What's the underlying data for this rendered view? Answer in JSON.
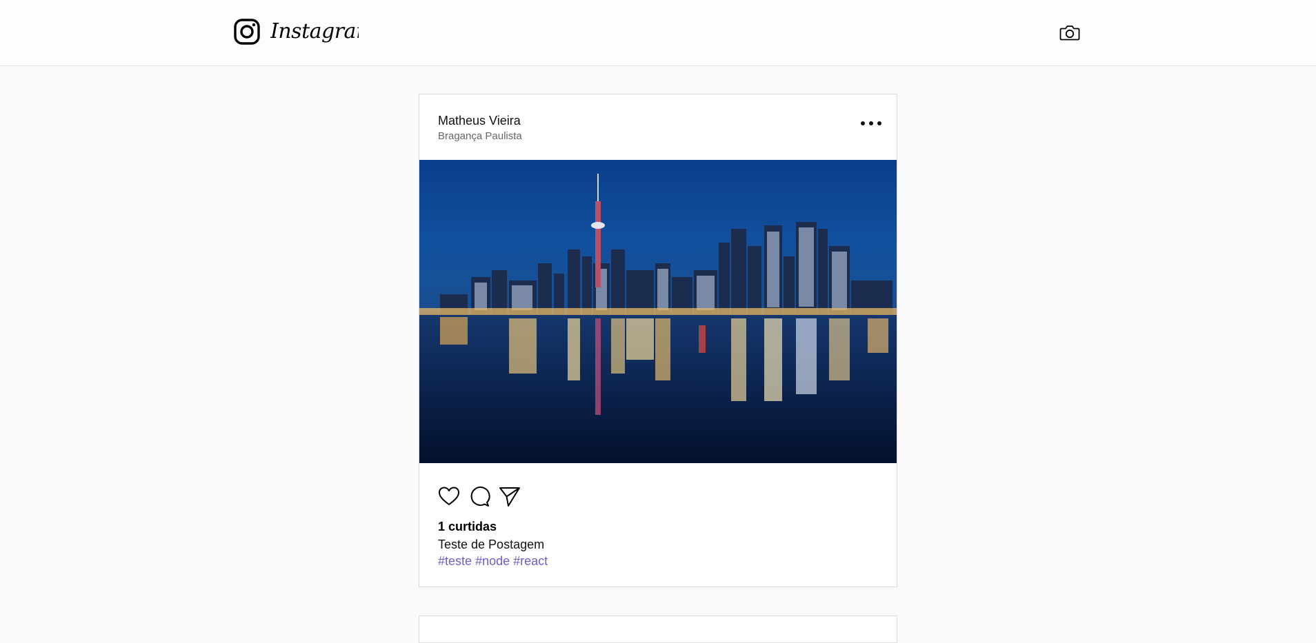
{
  "header": {
    "brand": "Instagram",
    "icons": {
      "logo": "instagram-glyph-icon",
      "camera": "camera-icon"
    }
  },
  "feed": {
    "posts": [
      {
        "author": "Matheus Vieira",
        "place": "Bragança Paulista",
        "likes": "1 curtidas",
        "description": "Teste de Postagem",
        "hashtags": [
          "#teste",
          "#node",
          "#react"
        ],
        "icons": {
          "more": "more-options-icon",
          "like": "heart-icon",
          "comment": "comment-icon",
          "send": "send-icon"
        }
      }
    ]
  },
  "colors": {
    "background": "#fafafa",
    "card": "#ffffff",
    "border": "#dbdbdb",
    "hashtag": "#6d5fc9",
    "muted": "#666666"
  }
}
